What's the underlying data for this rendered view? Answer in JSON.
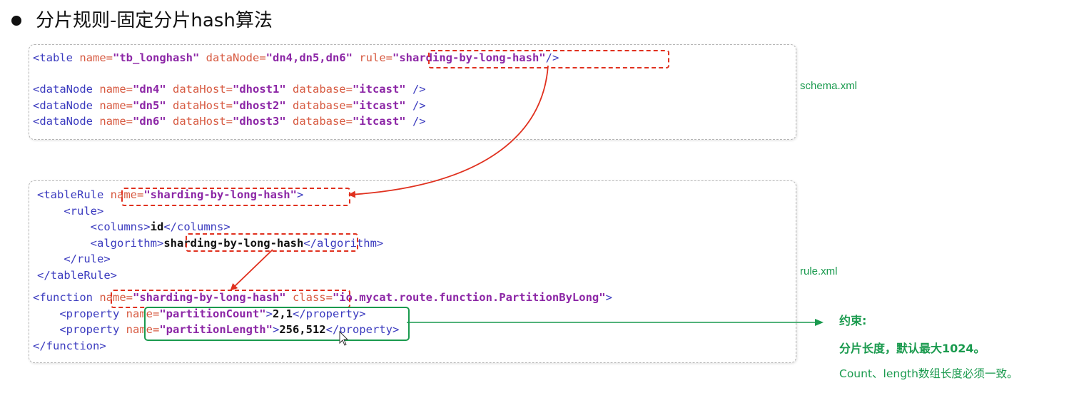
{
  "title": "分片规则-固定分片hash算法",
  "schema": {
    "label": "schema.xml",
    "table_line": {
      "open": "<table ",
      "name_attr": "name=",
      "name_val": "\"tb_longhash\"",
      "datanode_attr": " dataNode=",
      "datanode_val": "\"dn4,dn5,dn6\"",
      "rule_attr": "rule=",
      "rule_val": "\"sharding-by-long-hash\"",
      "close": "/>"
    },
    "datanodes": [
      {
        "open": "<dataNode ",
        "name_attr": "name=",
        "name_val": "\"dn4\"",
        "host_attr": " dataHost=",
        "host_val": "\"dhost1\"",
        "db_attr": " database=",
        "db_val": "\"itcast\"",
        "close": " />"
      },
      {
        "open": "<dataNode ",
        "name_attr": "name=",
        "name_val": "\"dn5\"",
        "host_attr": " dataHost=",
        "host_val": "\"dhost2\"",
        "db_attr": " database=",
        "db_val": "\"itcast\"",
        "close": " />"
      },
      {
        "open": "<dataNode ",
        "name_attr": "name=",
        "name_val": "\"dn6\"",
        "host_attr": " dataHost=",
        "host_val": "\"dhost3\"",
        "db_attr": " database=",
        "db_val": "\"itcast\"",
        "close": " />"
      }
    ]
  },
  "rule": {
    "label": "rule.xml",
    "tablerule_open": "<tableRule ",
    "tablerule_name_attr": "name=",
    "tablerule_name_val": "\"sharding-by-long-hash\"",
    "tablerule_open_end": ">",
    "rule_open": "<rule>",
    "columns_open": "<columns>",
    "columns_val": "id",
    "columns_close": "</columns>",
    "algorithm_open": "<algorithm>",
    "algorithm_val": "sharding-by-long-hash",
    "algorithm_close": "</algorithm>",
    "rule_close": "</rule>",
    "tablerule_close": "</tableRule>",
    "function_open": "<function ",
    "function_name_attr": "name=",
    "function_name_val": "\"sharding-by-long-hash\"",
    "function_class_attr": " class=",
    "function_class_val": "\"io.mycat.route.function.PartitionByLong\"",
    "function_open_end": ">",
    "properties": [
      {
        "open": "<property ",
        "name_attr": "name=",
        "name_val": "\"partitionCount\"",
        "gt": ">",
        "value": "2,1",
        "close": "</property>"
      },
      {
        "open": "<property ",
        "name_attr": "name=",
        "name_val": "\"partitionLength\"",
        "gt": ">",
        "value": "256,512",
        "close": "</property>"
      }
    ],
    "function_close": "</function>"
  },
  "constraint": {
    "heading": "约束:",
    "line1": "分片长度，默认最大1024。",
    "line2": "Count、length数组长度必须一致。"
  },
  "colors": {
    "tag": "#3b3bbf",
    "attribute": "#d75a41",
    "value": "#8c26a6",
    "highlight_red": "#e0311f",
    "highlight_green": "#1a9a4e"
  }
}
